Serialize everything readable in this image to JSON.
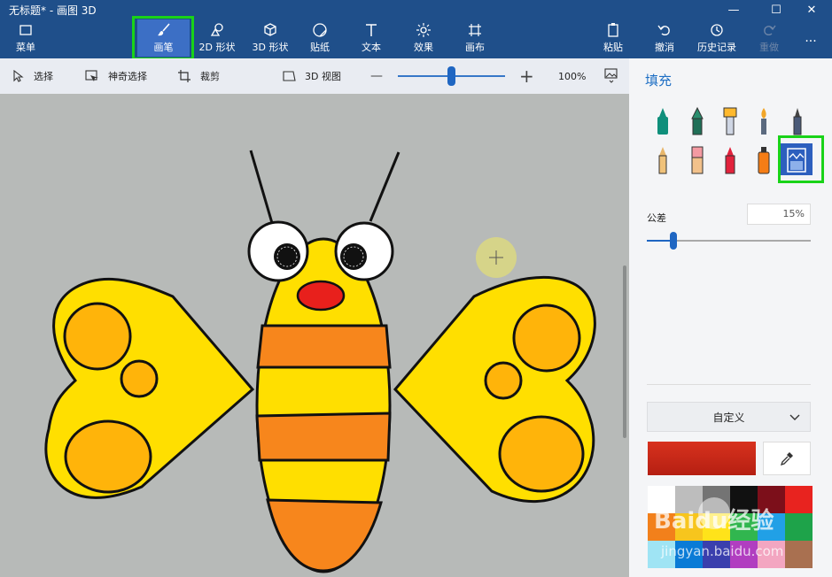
{
  "window": {
    "title": "无标题* - 画图 3D",
    "minimize": "—",
    "maximize": "☐",
    "close": "✕"
  },
  "ribbon": {
    "menu": "菜单",
    "tools": [
      "画笔",
      "2D 形状",
      "3D 形状",
      "贴纸",
      "文本",
      "效果",
      "画布"
    ],
    "paste": "粘贴",
    "undo": "撤消",
    "history": "历史记录",
    "redo": "重做",
    "more": "..."
  },
  "subtoolbar": {
    "select": "选择",
    "magic_select": "神奇选择",
    "crop": "裁剪",
    "view_3d": "3D 视图",
    "zoom_out": "—",
    "zoom_in": "+",
    "zoom_level": "100%",
    "zoom_fraction": 0.47
  },
  "panel": {
    "title": "填充",
    "tolerance_label": "公差",
    "tolerance_value": "15%",
    "tolerance_fraction": 0.15,
    "dropdown_label": "自定义",
    "selected_color": "#d8321e"
  },
  "palette": [
    "#ffffff",
    "#bdbdbd",
    "#747474",
    "#111111",
    "#7c0f1a",
    "#e8231f",
    "#f2801b",
    "#f7c51d",
    "#ffe31a",
    "#31b64f",
    "#21a0e6",
    "#1ea34a",
    "#9fe4f4",
    "#0a7bd6",
    "#3a3fad",
    "#b13ec0",
    "#f3a6c1",
    "#a97050"
  ],
  "colors": {
    "titlebar": "#1f4f8a",
    "accent": "#1f66c2",
    "highlight": "#19d318"
  },
  "watermark": {
    "brand": "Baidu经验",
    "url": "jingyan.baidu.com"
  }
}
